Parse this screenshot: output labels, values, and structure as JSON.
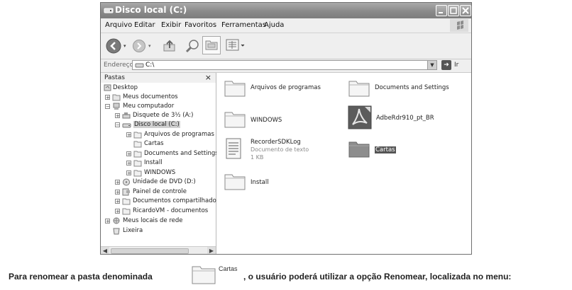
{
  "window": {
    "title": "Disco local (C:)",
    "buttons": [
      "minimize",
      "maximize",
      "close"
    ]
  },
  "menubar": [
    "Arquivo",
    "Editar",
    "Exibir",
    "Favoritos",
    "Ferramentas",
    "Ajuda"
  ],
  "toolbar": {
    "icons": [
      "back-icon",
      "forward-icon",
      "up-folder-icon",
      "search-icon",
      "folders-icon",
      "views-icon"
    ]
  },
  "address": {
    "label": "Endereço",
    "value": "C:\\",
    "go_label": "Ir"
  },
  "folders_pane": {
    "title": "Pastas",
    "close": "×",
    "tree": [
      {
        "label": "Desktop"
      },
      {
        "label": "Meus documentos"
      },
      {
        "label": "Meu computador"
      },
      {
        "label": "Disquete de 3½ (A:)"
      },
      {
        "label": "Disco local (C:)",
        "selected": true
      },
      {
        "label": "Arquivos de programas"
      },
      {
        "label": "Cartas"
      },
      {
        "label": "Documents and Settings"
      },
      {
        "label": "Install"
      },
      {
        "label": "WINDOWS"
      },
      {
        "label": "Unidade de DVD (D:)"
      },
      {
        "label": "Painel de controle"
      },
      {
        "label": "Documentos compartilhados"
      },
      {
        "label": "RicardoVM - documentos"
      },
      {
        "label": "Meus locais de rede"
      },
      {
        "label": "Lixeira"
      }
    ]
  },
  "content": {
    "items": [
      {
        "label": "Arquivos de programas",
        "type": "folder"
      },
      {
        "label": "Documents and Settings",
        "type": "folder"
      },
      {
        "label": "WINDOWS",
        "type": "folder"
      },
      {
        "label": "AdbeRdr910_pt_BR",
        "type": "acrobat"
      },
      {
        "label": "RecorderSDKLog",
        "line2": "Documento de texto",
        "line3": "1 KB",
        "type": "text-file"
      },
      {
        "label": "Cartas",
        "type": "folder",
        "selected": true
      },
      {
        "label": "Install",
        "type": "folder"
      }
    ]
  },
  "caption": {
    "before": "Para renomear a pasta denominada",
    "folder_name": "Cartas",
    "after": ", o usuário poderá utilizar a opção Renomear, localizada no menu:"
  }
}
